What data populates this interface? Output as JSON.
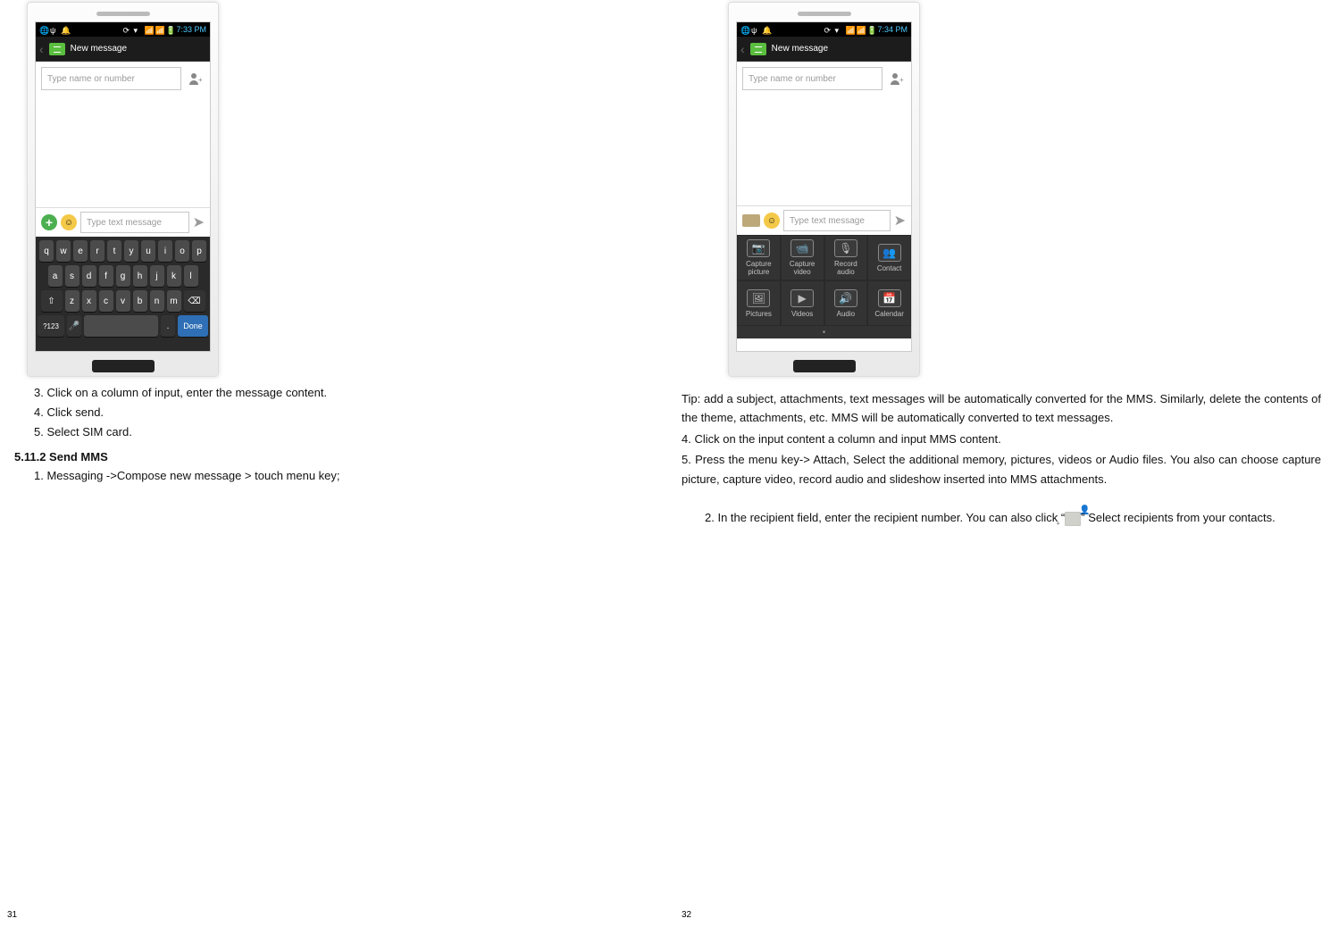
{
  "pageNumbers": {
    "left": "31",
    "right": "32"
  },
  "phoneLeft": {
    "time": "7:33 PM",
    "appbarTitle": "New message",
    "recipientPlaceholder": "Type name or number",
    "composePlaceholder": "Type text message",
    "keyboard": {
      "row1": [
        "q",
        "w",
        "e",
        "r",
        "t",
        "y",
        "u",
        "i",
        "o",
        "p"
      ],
      "row2": [
        "a",
        "s",
        "d",
        "f",
        "g",
        "h",
        "j",
        "k",
        "l"
      ],
      "row3_shift": "⇧",
      "row3": [
        "z",
        "x",
        "c",
        "v",
        "b",
        "n",
        "m"
      ],
      "row3_bksp": "⌫",
      "row4_sym": "?123",
      "row4_mic": "🎤",
      "row4_dot": ".",
      "row4_done": "Done"
    }
  },
  "phoneRight": {
    "time": "7:34 PM",
    "appbarTitle": "New message",
    "recipientPlaceholder": "Type name or number",
    "composePlaceholder": "Type text message",
    "attachments": [
      {
        "icon": "📷",
        "label": "Capture picture"
      },
      {
        "icon": "📹",
        "label": "Capture video"
      },
      {
        "icon": "🎙",
        "label": "Record audio"
      },
      {
        "icon": "👥",
        "label": "Contact"
      },
      {
        "icon": "🖼",
        "label": "Pictures"
      },
      {
        "icon": "▶",
        "label": "Videos"
      },
      {
        "icon": "🔊",
        "label": "Audio"
      },
      {
        "icon": "📅",
        "label": "Calendar"
      }
    ]
  },
  "leftText": {
    "l3": "3. Click on a column of input, enter the message content.",
    "l4": "4. Click send.",
    "l5": "5. Select SIM card.",
    "heading": "5.11.2  Send MMS",
    "step1": "1. Messaging ->Compose new message > touch menu key;"
  },
  "rightText": {
    "tip": "Tip: add a subject, attachments, text messages will be automatically converted for the MMS. Similarly, delete the contents of the theme, attachments, etc. MMS will be automatically converted to text messages.",
    "r4": "4. Click on the input content a column and input MMS content.",
    "r5": "5. Press the menu key-> Attach, Select the additional memory, pictures, videos or Audio files. You also can choose capture picture, capture video, record audio and slideshow inserted into MMS attachments.",
    "r2a": "2. In the recipient field, enter the recipient number. You can also click “",
    "r2b": "” Select recipients from your contacts."
  }
}
